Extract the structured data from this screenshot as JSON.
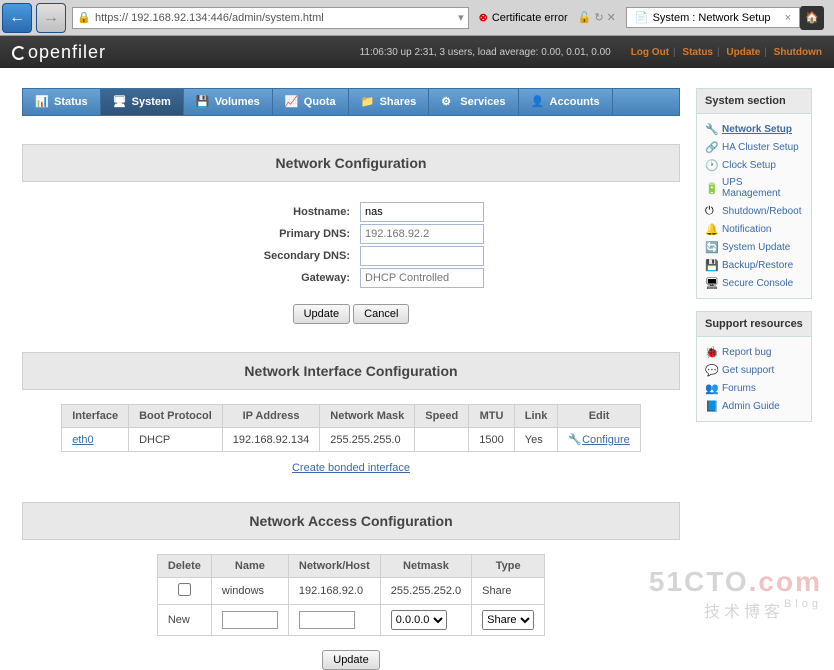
{
  "browser": {
    "url": "https:// 192.168.92.134:446/admin/system.html",
    "cert_error": "Certificate error",
    "tab_title": "System : Network Setup"
  },
  "header": {
    "logo": "openfiler",
    "uptime": "11:06:30 up 2:31, 3 users, load average: 0.00, 0.01, 0.00",
    "links": {
      "logout": "Log Out",
      "status": "Status",
      "update": "Update",
      "shutdown": "Shutdown"
    }
  },
  "tabs": [
    {
      "label": "Status"
    },
    {
      "label": "System"
    },
    {
      "label": "Volumes"
    },
    {
      "label": "Quota"
    },
    {
      "label": "Shares"
    },
    {
      "label": "Services"
    },
    {
      "label": "Accounts"
    }
  ],
  "netcfg": {
    "title": "Network Configuration",
    "hostname_label": "Hostname:",
    "hostname_value": "nas",
    "primary_dns_label": "Primary DNS:",
    "primary_dns_placeholder": "192.168.92.2",
    "secondary_dns_label": "Secondary DNS:",
    "gateway_label": "Gateway:",
    "gateway_placeholder": "DHCP Controlled",
    "update_btn": "Update",
    "cancel_btn": "Cancel"
  },
  "nic": {
    "title": "Network Interface Configuration",
    "headers": [
      "Interface",
      "Boot Protocol",
      "IP Address",
      "Network Mask",
      "Speed",
      "MTU",
      "Link",
      "Edit"
    ],
    "row": {
      "interface": "eth0",
      "boot": "DHCP",
      "ip": "192.168.92.134",
      "mask": "255.255.255.0",
      "speed": "",
      "mtu": "1500",
      "link": "Yes",
      "edit": "Configure"
    },
    "bonded_link": "Create bonded interface"
  },
  "nac": {
    "title": "Network Access Configuration",
    "headers": [
      "Delete",
      "Name",
      "Network/Host",
      "Netmask",
      "Type"
    ],
    "row1": {
      "name": "windows",
      "nethost": "192.168.92.0",
      "mask": "255.255.252.0",
      "type": "Share"
    },
    "new_label": "New",
    "netmask_default": "0.0.0.0",
    "type_default": "Share",
    "update_btn": "Update"
  },
  "sidebar": {
    "section_title": "System section",
    "section_items": [
      {
        "label": "Network Setup"
      },
      {
        "label": "HA Cluster Setup"
      },
      {
        "label": "Clock Setup"
      },
      {
        "label": "UPS Management"
      },
      {
        "label": "Shutdown/Reboot"
      },
      {
        "label": "Notification"
      },
      {
        "label": "System Update"
      },
      {
        "label": "Backup/Restore"
      },
      {
        "label": "Secure Console"
      }
    ],
    "support_title": "Support resources",
    "support_items": [
      {
        "label": "Report bug"
      },
      {
        "label": "Get support"
      },
      {
        "label": "Forums"
      },
      {
        "label": "Admin Guide"
      }
    ]
  },
  "watermark": {
    "brand": "51CTO",
    "suffix": ".com",
    "sub": "技术博客",
    "blog": "Blog"
  }
}
